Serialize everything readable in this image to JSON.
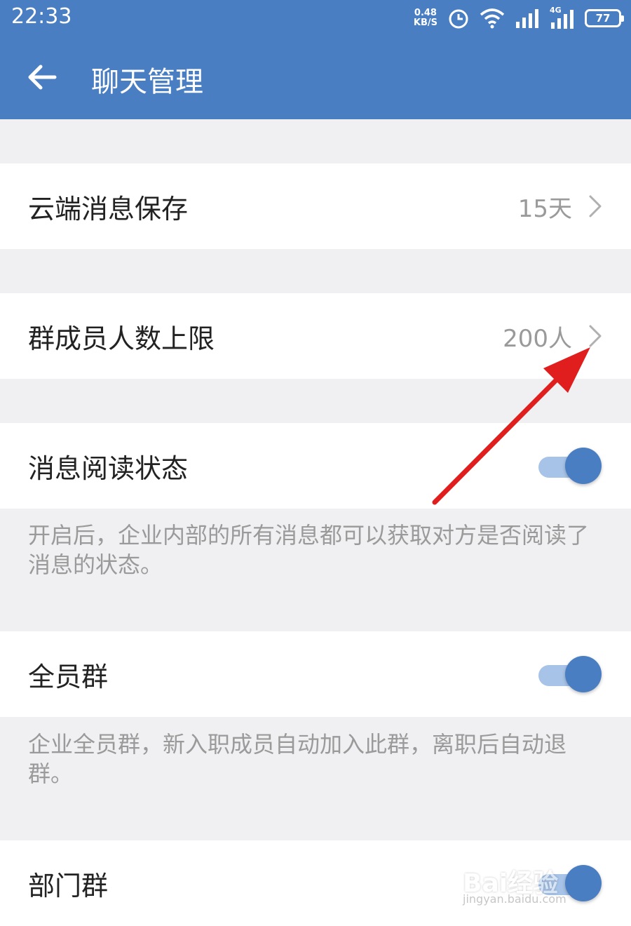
{
  "status_bar": {
    "time": "22:33",
    "net_speed_value": "0.48",
    "net_speed_unit": "KB/S",
    "network_type": "4G",
    "battery": "77"
  },
  "header": {
    "title": "聊天管理"
  },
  "settings": {
    "cloud_storage": {
      "label": "云端消息保存",
      "value": "15天"
    },
    "group_limit": {
      "label": "群成员人数上限",
      "value": "200人"
    },
    "read_status": {
      "label": "消息阅读状态",
      "enabled": true,
      "description": "开启后，企业内部的所有消息都可以获取对方是否阅读了消息的状态。"
    },
    "all_staff_group": {
      "label": "全员群",
      "enabled": true,
      "description": "企业全员群，新入职成员自动加入此群，离职后自动退群。"
    },
    "department_group": {
      "label": "部门群",
      "enabled": true
    }
  },
  "watermark": {
    "text": "Bai经验",
    "sub": "jingyan.baidu.com"
  },
  "colors": {
    "header": "#4a7ec3",
    "toggle_knob": "#4a7ec3",
    "toggle_track": "#a7c3e8",
    "annotation_arrow": "#e01e1e"
  }
}
